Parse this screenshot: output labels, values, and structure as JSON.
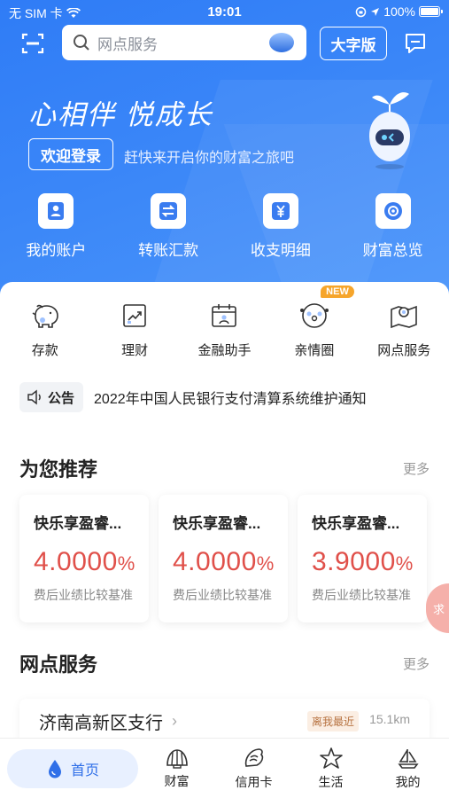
{
  "status_bar": {
    "carrier": "无 SIM 卡",
    "time": "19:01",
    "battery": "100%"
  },
  "search": {
    "placeholder": "网点服务"
  },
  "top_buttons": {
    "big_font": "大字版"
  },
  "hero": {
    "slogan": "心相伴 悦成长",
    "login_button": "欢迎登录",
    "login_tip": "赶快来开启你的财富之旅吧",
    "quick_actions": [
      {
        "label": "我的账户",
        "icon": "account-icon"
      },
      {
        "label": "转账汇款",
        "icon": "transfer-icon"
      },
      {
        "label": "收支明细",
        "icon": "yuan-icon"
      },
      {
        "label": "财富总览",
        "icon": "wealth-icon"
      }
    ]
  },
  "menu": [
    {
      "label": "存款",
      "icon": "piggy-bank-icon"
    },
    {
      "label": "理财",
      "icon": "trend-chart-icon"
    },
    {
      "label": "金融助手",
      "icon": "calendar-user-icon"
    },
    {
      "label": "亲情圈",
      "icon": "family-icon",
      "badge": "NEW"
    },
    {
      "label": "网点服务",
      "icon": "map-pin-icon"
    }
  ],
  "notice": {
    "tag": "公告",
    "text": "2022年中国人民银行支付清算系统维护通知"
  },
  "recommend": {
    "title": "为您推荐",
    "more": "更多",
    "items": [
      {
        "name": "快乐享盈睿...",
        "rate": "4.0000",
        "unit": "%",
        "desc": "费后业绩比较基准"
      },
      {
        "name": "快乐享盈睿...",
        "rate": "4.0000",
        "unit": "%",
        "desc": "费后业绩比较基准"
      },
      {
        "name": "快乐享盈睿...",
        "rate": "3.9000",
        "unit": "%",
        "desc": "费后业绩比较基准"
      }
    ]
  },
  "float_help": {
    "text": "求"
  },
  "branch": {
    "title": "网点服务",
    "more": "更多",
    "name": "济南高新区支行",
    "tag": "离我最近",
    "distance": "15.1km"
  },
  "tabbar": [
    {
      "label": "首页",
      "icon": "home-drop-icon",
      "active": true
    },
    {
      "label": "财富",
      "icon": "shell-icon"
    },
    {
      "label": "信用卡",
      "icon": "conch-icon"
    },
    {
      "label": "生活",
      "icon": "starfish-icon"
    },
    {
      "label": "我的",
      "icon": "sailboat-icon"
    }
  ],
  "colors": {
    "primary": "#2f7cf6",
    "rate_red": "#e0504a",
    "badge_orange": "#f6a52b"
  }
}
